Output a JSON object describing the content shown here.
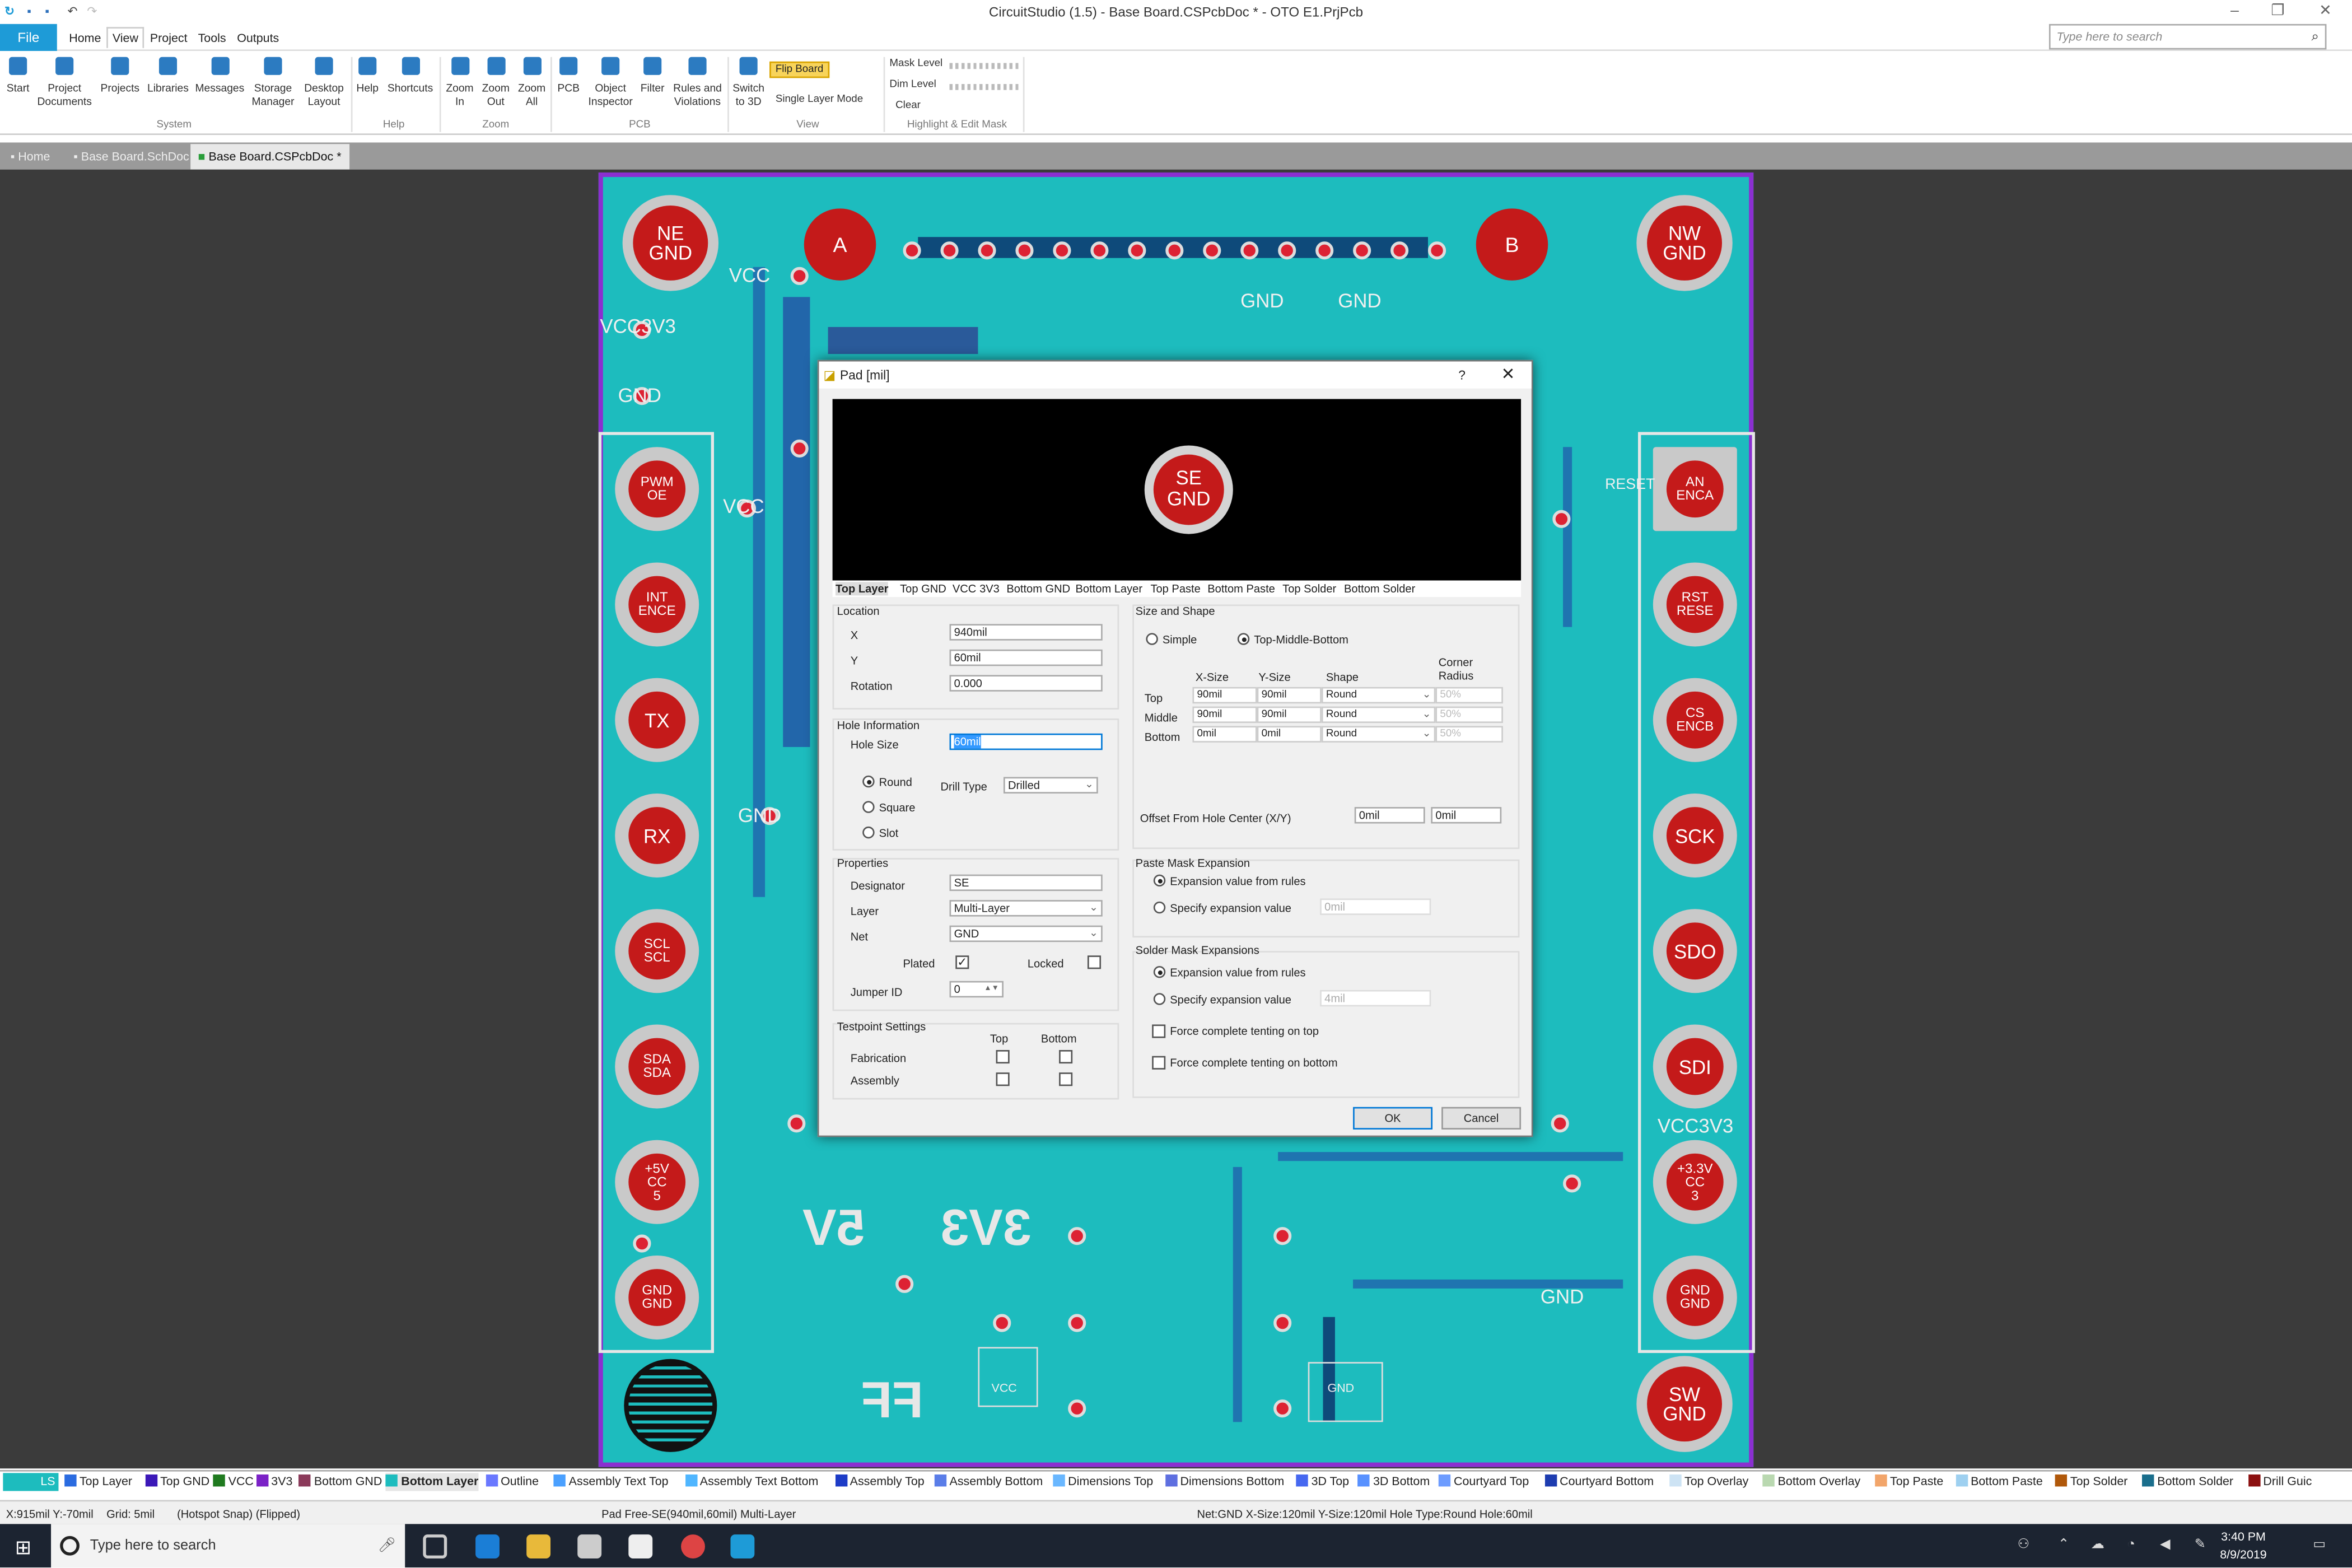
{
  "titlebar": {
    "title": "CircuitStudio (1.5) - Base Board.CSPcbDoc * - OTO E1.PrjPcb"
  },
  "menu": {
    "file": "File",
    "items": [
      "Home",
      "View",
      "Project",
      "Tools",
      "Outputs"
    ],
    "active": "View"
  },
  "search": {
    "placeholder": "Type here to search"
  },
  "ribbon": {
    "buttons": [
      {
        "label": "Start"
      },
      {
        "label": "Project\nDocuments"
      },
      {
        "label": "Projects"
      },
      {
        "label": "Libraries"
      },
      {
        "label": "Messages"
      },
      {
        "label": "Storage\nManager"
      },
      {
        "label": "Desktop\nLayout"
      },
      {
        "label": "Help"
      },
      {
        "label": "Shortcuts"
      },
      {
        "label": "Zoom\nIn"
      },
      {
        "label": "Zoom\nOut"
      },
      {
        "label": "Zoom\nAll"
      },
      {
        "label": "PCB"
      },
      {
        "label": "Object\nInspector"
      },
      {
        "label": "Filter"
      },
      {
        "label": "Rules and\nViolations"
      },
      {
        "label": "Switch\nto 3D"
      }
    ],
    "groups": [
      "System",
      "Help",
      "Zoom",
      "PCB",
      "View",
      "Highlight & Edit Mask"
    ],
    "flip_board": "Flip Board",
    "single_layer": "Single Layer Mode",
    "mask_level": "Mask Level",
    "dim_level": "Dim Level",
    "clear": "Clear"
  },
  "doctabs": [
    "Home",
    "Base Board.SchDoc",
    "Base Board.CSPcbDoc *"
  ],
  "board": {
    "pads_left": [
      "PWM OE",
      "INT ENCE",
      "TX",
      "RX",
      "SCL SCL",
      "SDA SDA",
      "+5V CC 5"
    ],
    "pads_right": [
      "AN ENCA",
      "RST RESE",
      "CS ENCB",
      "SCK",
      "SDO",
      "SDI",
      "+3.3V CC 3"
    ],
    "corner_ne": "NE GND",
    "corner_nw": "NW GND",
    "corner_sw": "SW GND",
    "gnd_left": "GND GND",
    "gnd_right": "GND GND",
    "pad_a": "A",
    "pad_b": "B",
    "silk_5v": "5V",
    "silk_3v3": "3V3",
    "silk_ff": "FF",
    "labels": {
      "vcc": "VCC",
      "vcc3v3": "VCC3V3",
      "gnd": "GND",
      "reset": "RESET"
    }
  },
  "dialog": {
    "title": "Pad [mil]",
    "help": "?",
    "close": "✕",
    "preview_text": "SE GND",
    "layer_tabs": [
      "Top Layer",
      "Top GND",
      "VCC",
      "3V3",
      "Bottom GND",
      "Bottom Layer",
      "Top Paste",
      "Bottom Paste",
      "Top Solder",
      "Bottom Solder"
    ],
    "location": {
      "heading": "Location",
      "x_label": "X",
      "x": "940mil",
      "y_label": "Y",
      "y": "60mil",
      "rot_label": "Rotation",
      "rotation": "0.000"
    },
    "hole": {
      "heading": "Hole Information",
      "size_label": "Hole Size",
      "size": "60mil",
      "round": "Round",
      "square": "Square",
      "slot": "Slot",
      "drill_label": "Drill Type",
      "drill": "Drilled"
    },
    "props": {
      "heading": "Properties",
      "des_label": "Designator",
      "designator": "SE",
      "layer_label": "Layer",
      "layer": "Multi-Layer",
      "net_label": "Net",
      "net": "GND",
      "plated": "Plated",
      "locked": "Locked",
      "jumper_label": "Jumper ID",
      "jumper": "0"
    },
    "testpoint": {
      "heading": "Testpoint Settings",
      "top": "Top",
      "bottom": "Bottom",
      "fab": "Fabrication",
      "asm": "Assembly"
    },
    "size": {
      "heading": "Size and Shape",
      "simple": "Simple",
      "tmb": "Top-Middle-Bottom",
      "xsize": "X-Size",
      "ysize": "Y-Size",
      "shape": "Shape",
      "corner": "Corner\nRadius",
      "rows": [
        {
          "name": "Top",
          "x": "90mil",
          "y": "90mil",
          "shape": "Round",
          "r": "50%"
        },
        {
          "name": "Middle",
          "x": "90mil",
          "y": "90mil",
          "shape": "Round",
          "r": "50%"
        },
        {
          "name": "Bottom",
          "x": "0mil",
          "y": "0mil",
          "shape": "Round",
          "r": "50%"
        }
      ],
      "offset_label": "Offset From Hole Center (X/Y)",
      "offx": "0mil",
      "offy": "0mil"
    },
    "paste": {
      "heading": "Paste Mask Expansion",
      "rules": "Expansion value from rules",
      "specify": "Specify expansion value",
      "val": "0mil"
    },
    "solder": {
      "heading": "Solder Mask Expansions",
      "rules": "Expansion value from rules",
      "specify": "Specify expansion value",
      "val": "4mil",
      "tent_top": "Force complete tenting on top",
      "tent_bot": "Force complete tenting on bottom"
    },
    "ok": "OK",
    "cancel": "Cancel"
  },
  "layerbar": {
    "ls": "LS",
    "layers": [
      {
        "name": "Top Layer",
        "color": "#2a6be0"
      },
      {
        "name": "Top GND",
        "color": "#3b18b8"
      },
      {
        "name": "VCC",
        "color": "#1f7a1f"
      },
      {
        "name": "3V3",
        "color": "#7b22c7"
      },
      {
        "name": "Bottom GND",
        "color": "#8b3a5a"
      },
      {
        "name": "Bottom Layer",
        "color": "#1dbcbe"
      },
      {
        "name": "Outline",
        "color": "#6a78ff"
      },
      {
        "name": "Assembly Text Top",
        "color": "#4aa0ff"
      },
      {
        "name": "Assembly Text Bottom",
        "color": "#4fb6ff"
      },
      {
        "name": "Assembly Top",
        "color": "#1d3cc7"
      },
      {
        "name": "Assembly Bottom",
        "color": "#5a7de8"
      },
      {
        "name": "Dimensions Top",
        "color": "#69b7ff"
      },
      {
        "name": "Dimensions Bottom",
        "color": "#5e6fe0"
      },
      {
        "name": "3D Top",
        "color": "#4668f0"
      },
      {
        "name": "3D Bottom",
        "color": "#5891ff"
      },
      {
        "name": "Courtyard Top",
        "color": "#6d9cff"
      },
      {
        "name": "Courtyard Bottom",
        "color": "#1d3cb0"
      },
      {
        "name": "Top Overlay",
        "color": "#cde3f4"
      },
      {
        "name": "Bottom Overlay",
        "color": "#b9d8b0"
      },
      {
        "name": "Top Paste",
        "color": "#f2a56a"
      },
      {
        "name": "Bottom Paste",
        "color": "#9ed0f0"
      },
      {
        "name": "Top Solder",
        "color": "#b0580a"
      },
      {
        "name": "Bottom Solder",
        "color": "#1a6e8c"
      },
      {
        "name": "Drill Guic",
        "color": "#8b1010"
      }
    ]
  },
  "status": {
    "coords": "X:915mil Y:-70mil",
    "grid": "Grid: 5mil",
    "snap": "(Hotspot Snap) (Flipped)",
    "pad": "Pad Free-SE(940mil,60mil)  Multi-Layer",
    "net": "Net:GND X-Size:120mil Y-Size:120mil Hole Type:Round Hole:60mil"
  },
  "taskbar": {
    "search": "Type here to search",
    "time": "3:40 PM",
    "date": "8/9/2019"
  }
}
